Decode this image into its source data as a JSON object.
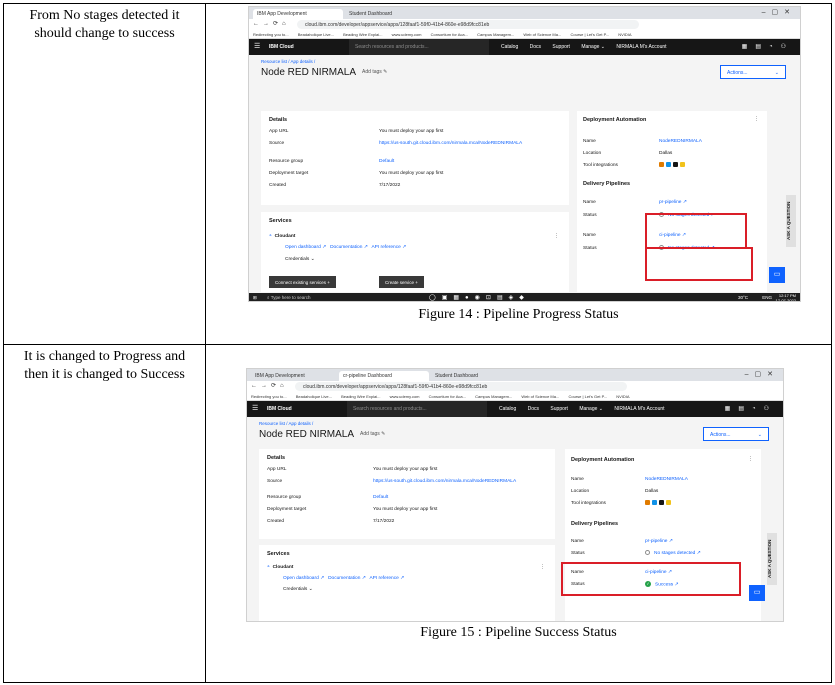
{
  "rows": [
    {
      "description": "From No stages detected it should change to success",
      "caption": "Figure 14 : Pipeline Progress Status"
    },
    {
      "description": "It is changed to Progress and then it is changed to Success",
      "caption": "Figure 15 : Pipeline Success Status"
    }
  ],
  "browser": {
    "tab1": "IBM App Development",
    "tab2_first": "Student Dashboard",
    "tab2_second": "cr-pipeline Dashboard",
    "tab3_second": "Student Dashboard",
    "url": "cloud.ibm.com/developer/appservice/apps/128faaf1-59f0-41b4-860e-e98d9fcc81eb",
    "bookmarks": [
      "Redirecting you to...",
      "Beadaholique Live...",
      "Beading Wire Explai...",
      "www.udemy.com",
      "Consortium for Aca...",
      "Campus Managem...",
      "Web of Science Ma...",
      "Course | Let's Get P...",
      "NVIDIA"
    ]
  },
  "ibm": {
    "brand": "IBM Cloud",
    "search_placeholder": "Search resources and products...",
    "menu": [
      "Catalog",
      "Docs",
      "Support",
      "Manage ⌄",
      "NIRMALA M's Account"
    ],
    "breadcrumb": "Resource list  /  App details  /",
    "title": "Node RED NIRMALA",
    "add_tags": "Add tags ✎",
    "actions": "Actions...",
    "details_title": "Details",
    "app_url_label": "App URL",
    "app_url_value": "You must deploy your app first",
    "source_label": "Source",
    "source_value": "https://us-south.git.cloud.ibm.com/nirmala.mca/NodeREDNIRMALA",
    "rg_label": "Resource group",
    "rg_value": "Default",
    "dt_label": "Deployment target",
    "dt_value": "You must deploy your app first",
    "created_label": "Created",
    "created_value": "7/17/2022",
    "services_title": "Services",
    "cloudant": "Cloudant",
    "open_dashboard": "Open dashboard ↗",
    "documentation": "Documentation ↗",
    "api_reference": "API reference ↗",
    "credentials": "Credentials ⌄",
    "connect_btn": "Connect existing services     +",
    "create_btn": "Create service     +",
    "da_title": "Deployment Automation",
    "name_label": "Name",
    "name_value": "NodeREDNIRMALA",
    "loc_label": "Location",
    "loc_value": "Dallas",
    "tool_label": "Tool integrations",
    "dp_title": "Delivery Pipelines",
    "status_label": "Status",
    "pr_pipeline": "pr-pipeline ↗",
    "ci_pipeline": "ci-pipeline ↗",
    "no_stages": "No stages detected ↗",
    "success": "Success ↗",
    "ask_question": "ASK A QUESTION"
  },
  "taskbar": {
    "search": "Type here to search",
    "weather": "30°C",
    "lang": "ENG",
    "time": "12:17 PM",
    "date": "17-07-2022"
  }
}
